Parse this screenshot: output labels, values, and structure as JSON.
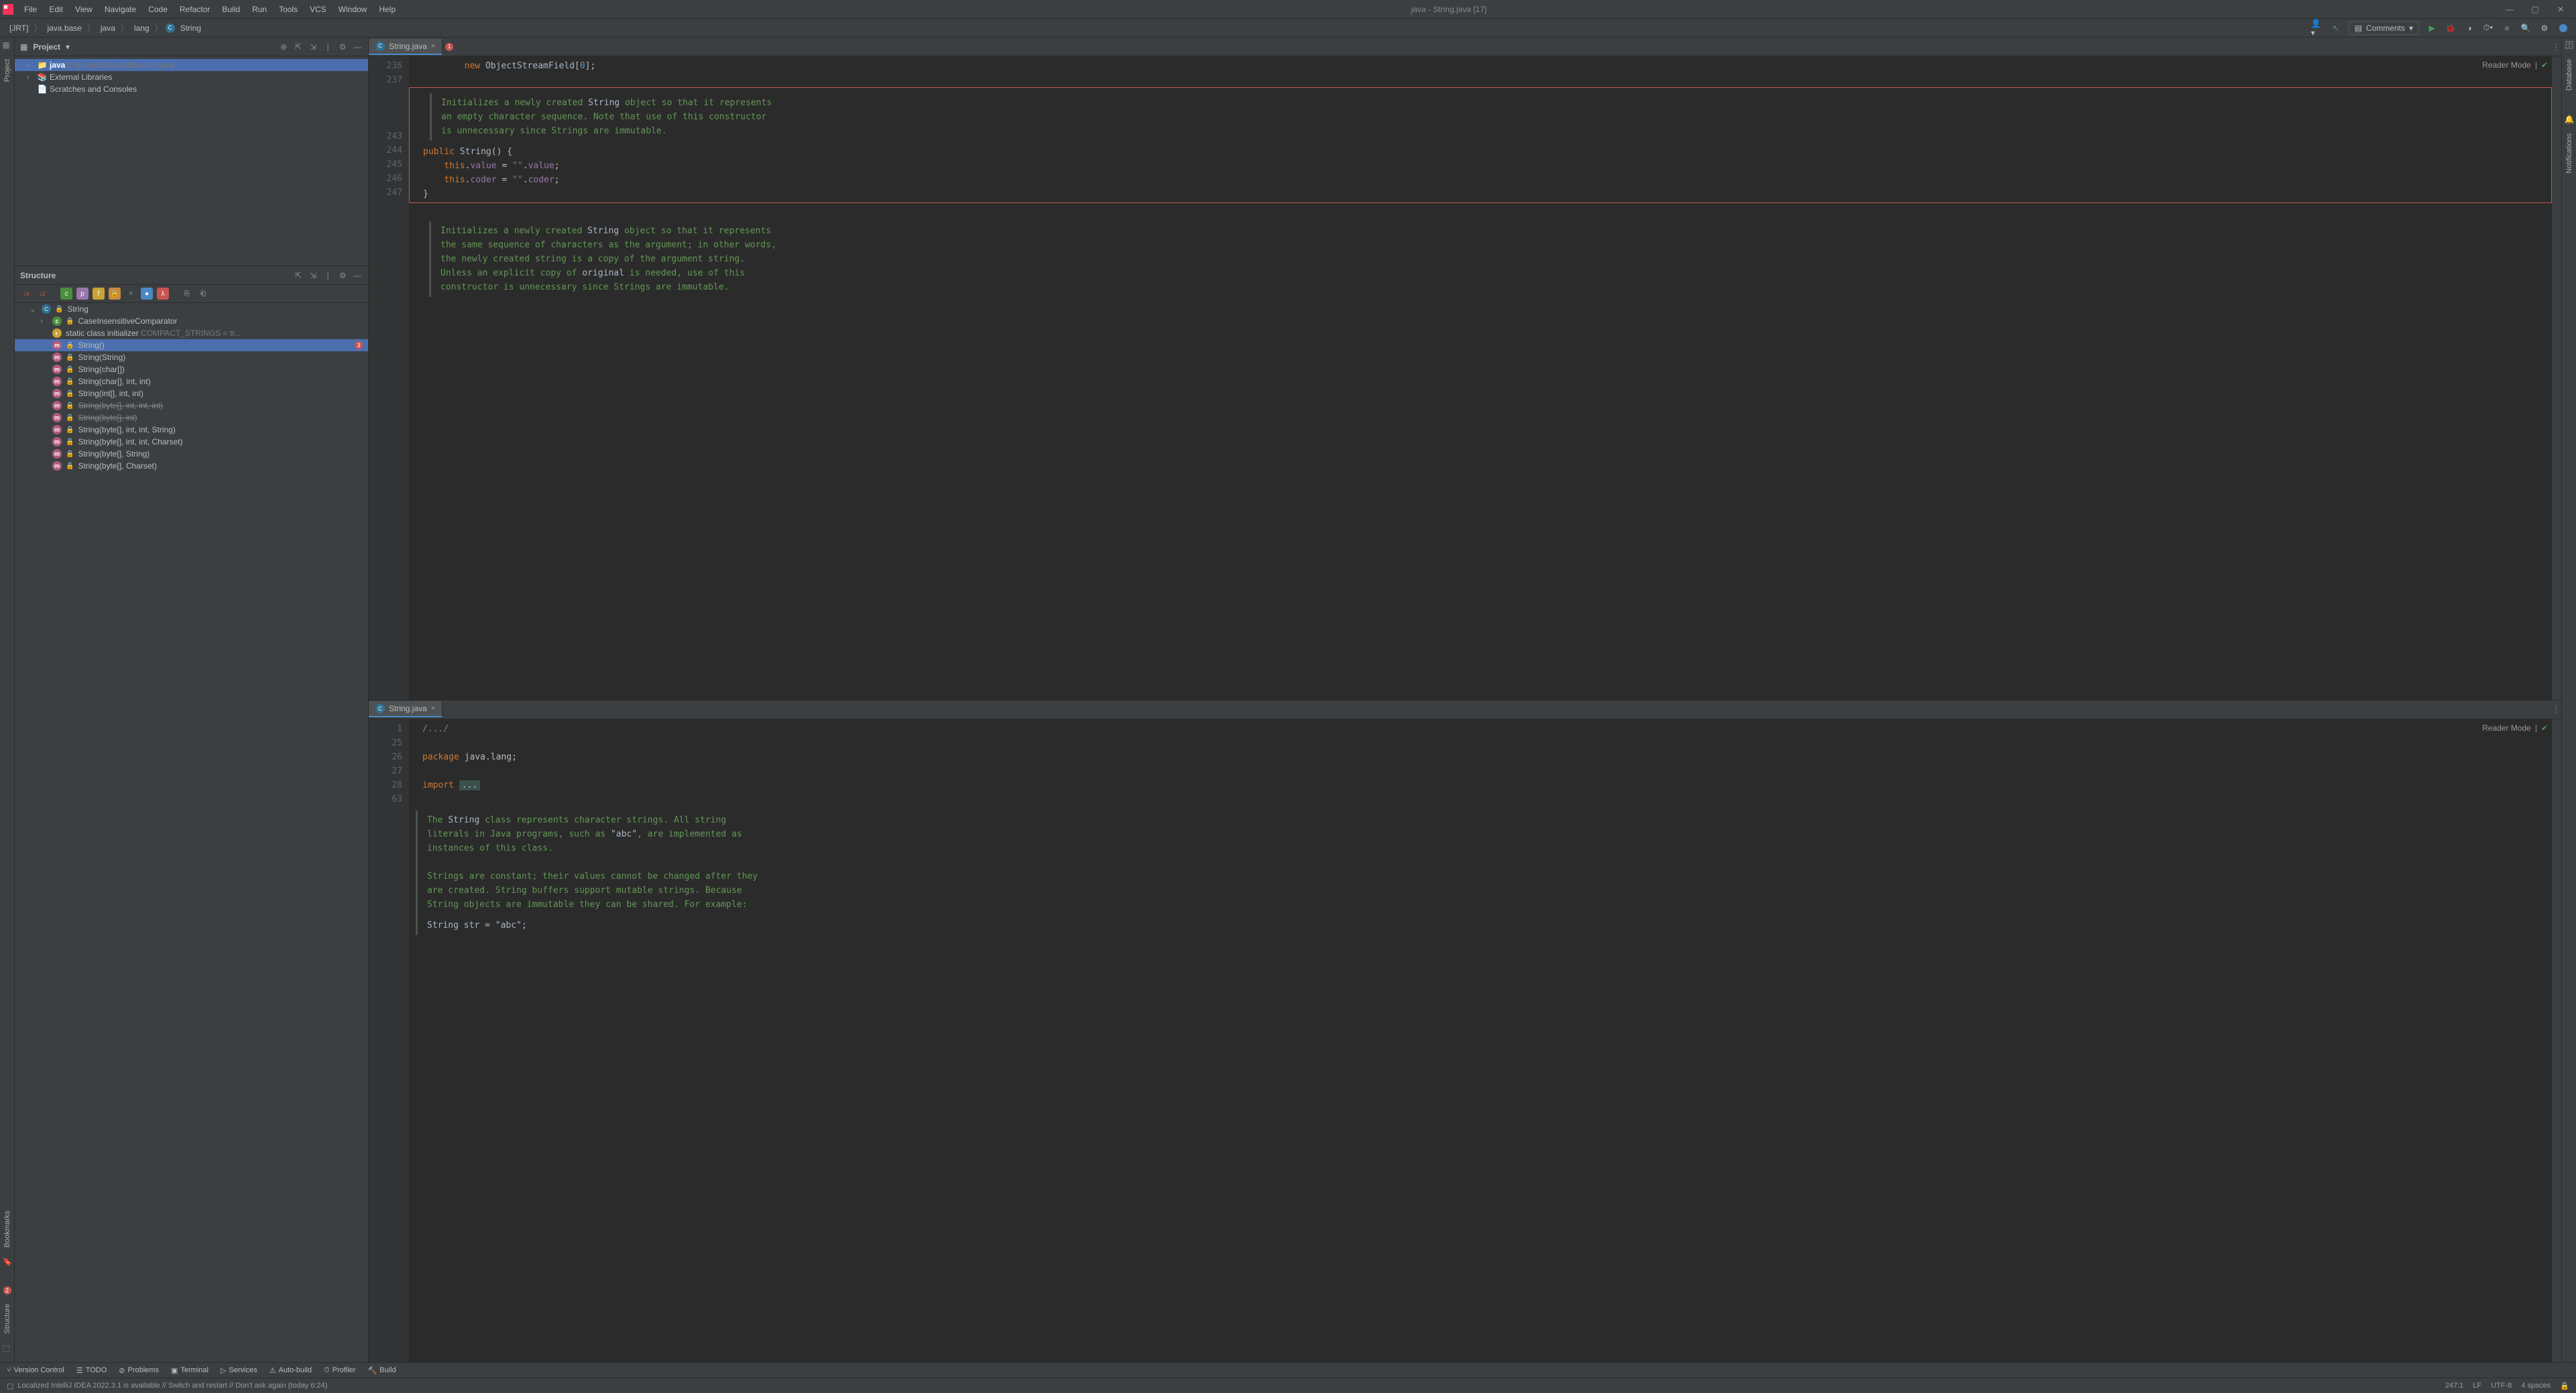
{
  "title": "java - String.java [17]",
  "menu": [
    "File",
    "Edit",
    "View",
    "Navigate",
    "Code",
    "Refactor",
    "Build",
    "Run",
    "Tools",
    "VCS",
    "Window",
    "Help"
  ],
  "breadcrumb": [
    "[JRT]",
    "java.base",
    "java",
    "lang",
    "String"
  ],
  "navbar": {
    "comments": "Comments"
  },
  "project_panel": {
    "title": "Project",
    "root": "java",
    "root_path": "D:\\projects\\java\\ittimeline\\java",
    "ext_libs": "External Libraries",
    "scratches": "Scratches and Consoles"
  },
  "structure_panel": {
    "title": "Structure",
    "class_name": "String",
    "items": [
      {
        "type": "class",
        "label": "CaseInsensitiveComparator",
        "indent": 2,
        "arrow": true,
        "lock": true
      },
      {
        "type": "init",
        "label": "static class initializer",
        "dim": "COMPACT_STRINGS = tr...",
        "indent": 2
      },
      {
        "type": "method",
        "label": "String()",
        "indent": 2,
        "selected": true,
        "lock": true,
        "badge": "3"
      },
      {
        "type": "method",
        "label": "String(String)",
        "indent": 2,
        "lock": true
      },
      {
        "type": "method",
        "label": "String(char[])",
        "indent": 2,
        "lock": true
      },
      {
        "type": "method",
        "label": "String(char[], int, int)",
        "indent": 2,
        "lock": true
      },
      {
        "type": "method",
        "label": "String(int[], int, int)",
        "indent": 2,
        "lock": true
      },
      {
        "type": "method",
        "label": "String(byte[], int, int, int)",
        "indent": 2,
        "lock": true,
        "strike": true
      },
      {
        "type": "method",
        "label": "String(byte[], int)",
        "indent": 2,
        "lock": true,
        "strike": true
      },
      {
        "type": "method",
        "label": "String(byte[], int, int, String)",
        "indent": 2,
        "lock": true
      },
      {
        "type": "method",
        "label": "String(byte[], int, int, Charset)",
        "indent": 2,
        "lock": true
      },
      {
        "type": "method",
        "label": "String(byte[], String)",
        "indent": 2,
        "lock": true
      },
      {
        "type": "method",
        "label": "String(byte[], Charset)",
        "indent": 2,
        "lock": true
      }
    ]
  },
  "editor_top": {
    "tab": "String.java",
    "tab_badge": "1",
    "reader_mode": "Reader Mode",
    "lines": [
      "236",
      "237",
      "",
      "",
      "",
      "243",
      "244",
      "245",
      "246",
      "247",
      "",
      "",
      "",
      "",
      ""
    ],
    "snippet_objstream": "new ObjectStreamField[0];",
    "javadoc1": "Initializes a newly created String object so that it represents an empty character sequence. Note that use of this constructor is unnecessary since Strings are immutable.",
    "code_sig": "public String() {",
    "code_l1": "    this.value = \"\".value;",
    "code_l2": "    this.coder = \"\".coder;",
    "code_l3": "}",
    "javadoc2": "Initializes a newly created String object so that it represents the same sequence of characters as the argument; in other words, the newly created string is a copy of the argument string. Unless an explicit copy of original is needed, use of this constructor is unnecessary since Strings are immutable."
  },
  "editor_bottom": {
    "tab": "String.java",
    "reader_mode": "Reader Mode",
    "lines": [
      "1",
      "25",
      "26",
      "27",
      "28",
      "63"
    ],
    "fold": "/.../",
    "pkg": "package java.lang;",
    "imp": "import ...",
    "javadoc": "The String class represents character strings. All string literals in Java programs, such as \"abc\", are implemented as instances of this class.",
    "javadoc_p2": "Strings are constant; their values cannot be changed after they are created. String buffers support mutable strings. Because String objects are immutable they can be shared. For example:",
    "example": "    String str = \"abc\";"
  },
  "bottom_tools": [
    "Version Control",
    "TODO",
    "Problems",
    "Terminal",
    "Services",
    "Auto-build",
    "Profiler",
    "Build"
  ],
  "status": {
    "msg": "Localized IntelliJ IDEA 2022.3.1 is available // Switch and restart // Don't ask again (today 6:24)",
    "pos": "247:1",
    "le": "LF",
    "enc": "UTF-8",
    "indent": "4 spaces"
  },
  "left_gutter": {
    "project": "Project",
    "bookmarks": "Bookmarks",
    "structure": "Structure",
    "badge": "2"
  },
  "right_gutter": {
    "database": "Database",
    "notifications": "Notifications"
  }
}
